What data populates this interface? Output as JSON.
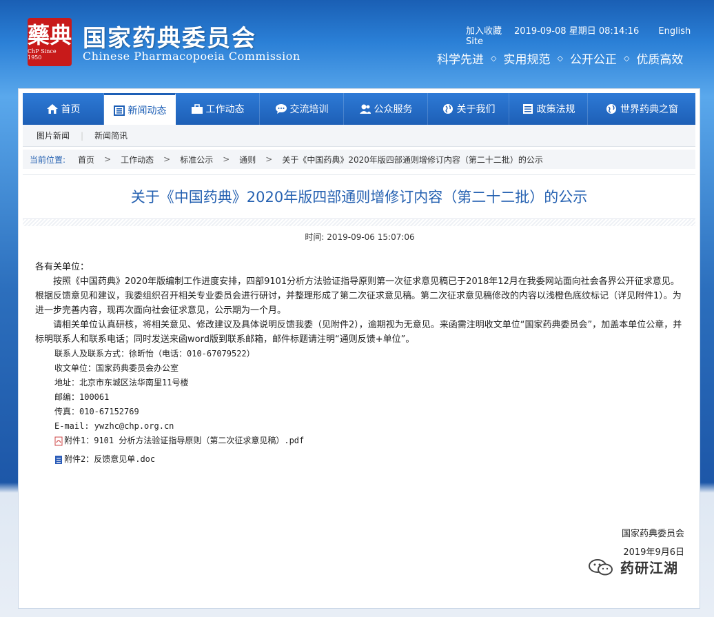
{
  "header": {
    "site_name_cn": "国家药典委员会",
    "site_name_en": "Chinese Pharmacopoeia Commission",
    "logo_since": "ChP Since 1950",
    "bookmark": "加入收藏",
    "datetime": "2019-09-08 星期日 08:14:16",
    "english_site": "English Site",
    "slogans": [
      "科学先进",
      "实用规范",
      "公开公正",
      "优质高效"
    ],
    "slogan_sep": "◇"
  },
  "nav": {
    "items": [
      {
        "label": "首页",
        "icon": "home-icon"
      },
      {
        "label": "新闻动态",
        "icon": "news-icon",
        "active": true
      },
      {
        "label": "工作动态",
        "icon": "briefcase-icon"
      },
      {
        "label": "交流培训",
        "icon": "chat-icon"
      },
      {
        "label": "公众服务",
        "icon": "people-icon"
      },
      {
        "label": "关于我们",
        "icon": "globe-icon"
      },
      {
        "label": "政策法规",
        "icon": "list-icon"
      },
      {
        "label": "世界药典之窗",
        "icon": "world-icon"
      }
    ],
    "sub_items": [
      "图片新闻",
      "新闻简讯"
    ]
  },
  "breadcrumb": {
    "label": "当前位置:",
    "items": [
      "首页",
      "工作动态",
      "标准公示",
      "通则"
    ],
    "current": "关于《中国药典》2020年版四部通则增修订内容（第二十二批）的公示",
    "sep": ">"
  },
  "article": {
    "title": "关于《中国药典》2020年版四部通则增修订内容（第二十二批）的公示",
    "time": "时间: 2019-09-06 15:07:06",
    "salutation": "各有关单位：",
    "para1": "按照《中国药典》2020年版编制工作进度安排，四部9101分析方法验证指导原则第一次征求意见稿已于2018年12月在我委网站面向社会各界公开征求意见。根据反馈意见和建议，我委组织召开相关专业委员会进行研讨，并整理形成了第二次征求意见稿。第二次征求意见稿修改的内容以浅橙色底纹标记（详见附件1）。为进一步完善内容，现再次面向社会征求意见，公示期为一个月。",
    "para2": "请相关单位认真研核，将相关意见、修改建议及具体说明反馈我委（见附件2），逾期视为无意见。来函需注明收文单位“国家药典委员会”，加盖本单位公章，并标明联系人和联系电话；同时发送来函word版到联系邮箱，邮件标题请注明“通则反馈+单位”。",
    "contact": "联系人及联系方式：徐昕怡（电话：010-67079522）",
    "receiver": "收文单位：国家药典委员会办公室",
    "address": "地址：北京市东城区法华南里11号楼",
    "postcode": "邮编：100061",
    "fax": "传真：010-67152769",
    "email": "E-mail: ywzhc@chp.org.cn",
    "attachment1": "附件1：9101 分析方法验证指导原则（第二次征求意见稿）.pdf",
    "attachment2": "附件2：反馈意见单.doc",
    "signer": "国家药典委员会",
    "sign_date": "2019年9月6日"
  },
  "watermark": {
    "text": "药研江湖",
    "icon": "wechat-icon"
  },
  "colors": {
    "nav_blue": "#1d5fb6",
    "title_blue": "#2561b1",
    "logo_red": "#c81a1a"
  }
}
